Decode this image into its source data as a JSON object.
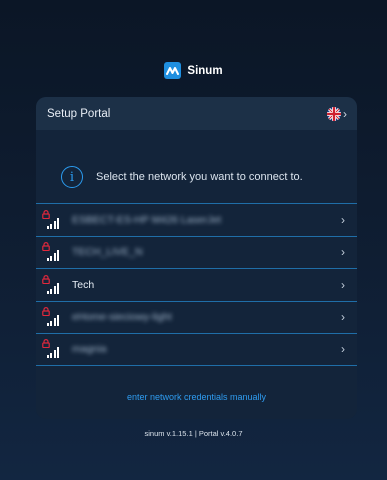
{
  "brand": {
    "name": "Sinum",
    "logo_icon": "sinum-logo-icon",
    "accent": "#1f8fe0"
  },
  "card": {
    "title": "Setup Portal",
    "language_icon": "uk-flag-icon",
    "info_icon": "info-icon",
    "instruction": "Select the network you want to connect to."
  },
  "networks": [
    {
      "name": "ESBECT-ES-HP M426 LaserJet",
      "locked": true,
      "blurred": true,
      "signal": 4
    },
    {
      "name": "TECH_LIVE_N",
      "locked": true,
      "blurred": true,
      "signal": 4
    },
    {
      "name": "Tech",
      "locked": true,
      "blurred": false,
      "signal": 4
    },
    {
      "name": "eHome-sieciowy-light",
      "locked": true,
      "blurred": true,
      "signal": 4
    },
    {
      "name": "magnia",
      "locked": true,
      "blurred": true,
      "signal": 4
    }
  ],
  "manual_link": "enter network credentials manually",
  "footer": {
    "version": "sinum v.1.15.1 | Portal v.4.0.7"
  },
  "colors": {
    "lock": "#e0283c",
    "link": "#2f9cf0",
    "divider": "#1f6ea8"
  }
}
